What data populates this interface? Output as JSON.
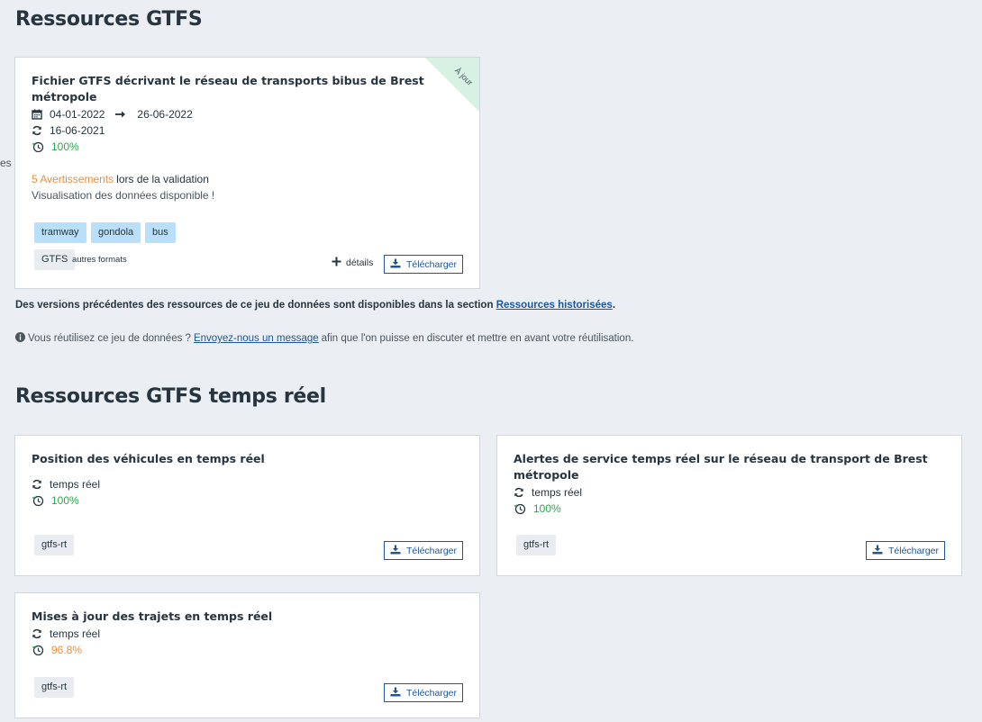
{
  "stray_text": "es",
  "gtfs_section": {
    "title": "Ressources GTFS",
    "card": {
      "title_line1": "Fichier GTFS décrivant le réseau de transports bibus de Brest",
      "title_line2": "métropole",
      "ribbon": "À jour",
      "start_date": "04-01-2022",
      "end_date": "26-06-2022",
      "updated": "16-06-2021",
      "availability": "100%",
      "warnings_count": "5 Avertissements",
      "warnings_suffix": "lors de la validation",
      "visualisation": "Visualisation des données disponible !",
      "modes": [
        "tramway",
        "gondola",
        "bus"
      ],
      "format": "GTFS",
      "other_formats": "autres formats",
      "details_label": "détails",
      "download_label": "Télécharger"
    },
    "history_note_prefix": "Des versions précédentes des ressources de ce jeu de données sont disponibles dans la section",
    "history_link": "Ressources historisées",
    "history_suffix": ".",
    "reuse_prefix": "Vous réutilisez ce jeu de données ?",
    "reuse_link": "Envoyez-nous un message",
    "reuse_suffix": "afin que l'on puisse en discuter et mettre en avant votre réutilisation."
  },
  "rt_section": {
    "title": "Ressources GTFS temps réel",
    "cards": [
      {
        "title_line1": "Position des véhicules en temps réel",
        "title_line2": "",
        "update": "temps réel",
        "availability": "100%",
        "format": "gtfs-rt",
        "download_label": "Télécharger"
      },
      {
        "title_line1": "Alertes de service temps réel sur le réseau de transport de Brest",
        "title_line2": "métropole",
        "update": "temps réel",
        "availability": "100%",
        "format": "gtfs-rt",
        "download_label": "Télécharger"
      },
      {
        "title_line1": "Mises à jour des trajets en temps réel",
        "title_line2": "",
        "update": "temps réel",
        "availability": "96.8%",
        "format": "gtfs-rt",
        "download_label": "Télécharger"
      }
    ]
  },
  "colors": {
    "ok": "#2fa44f",
    "warn": "#ef8d3c",
    "link": "#1e5797",
    "tag": "#b9dffa"
  }
}
